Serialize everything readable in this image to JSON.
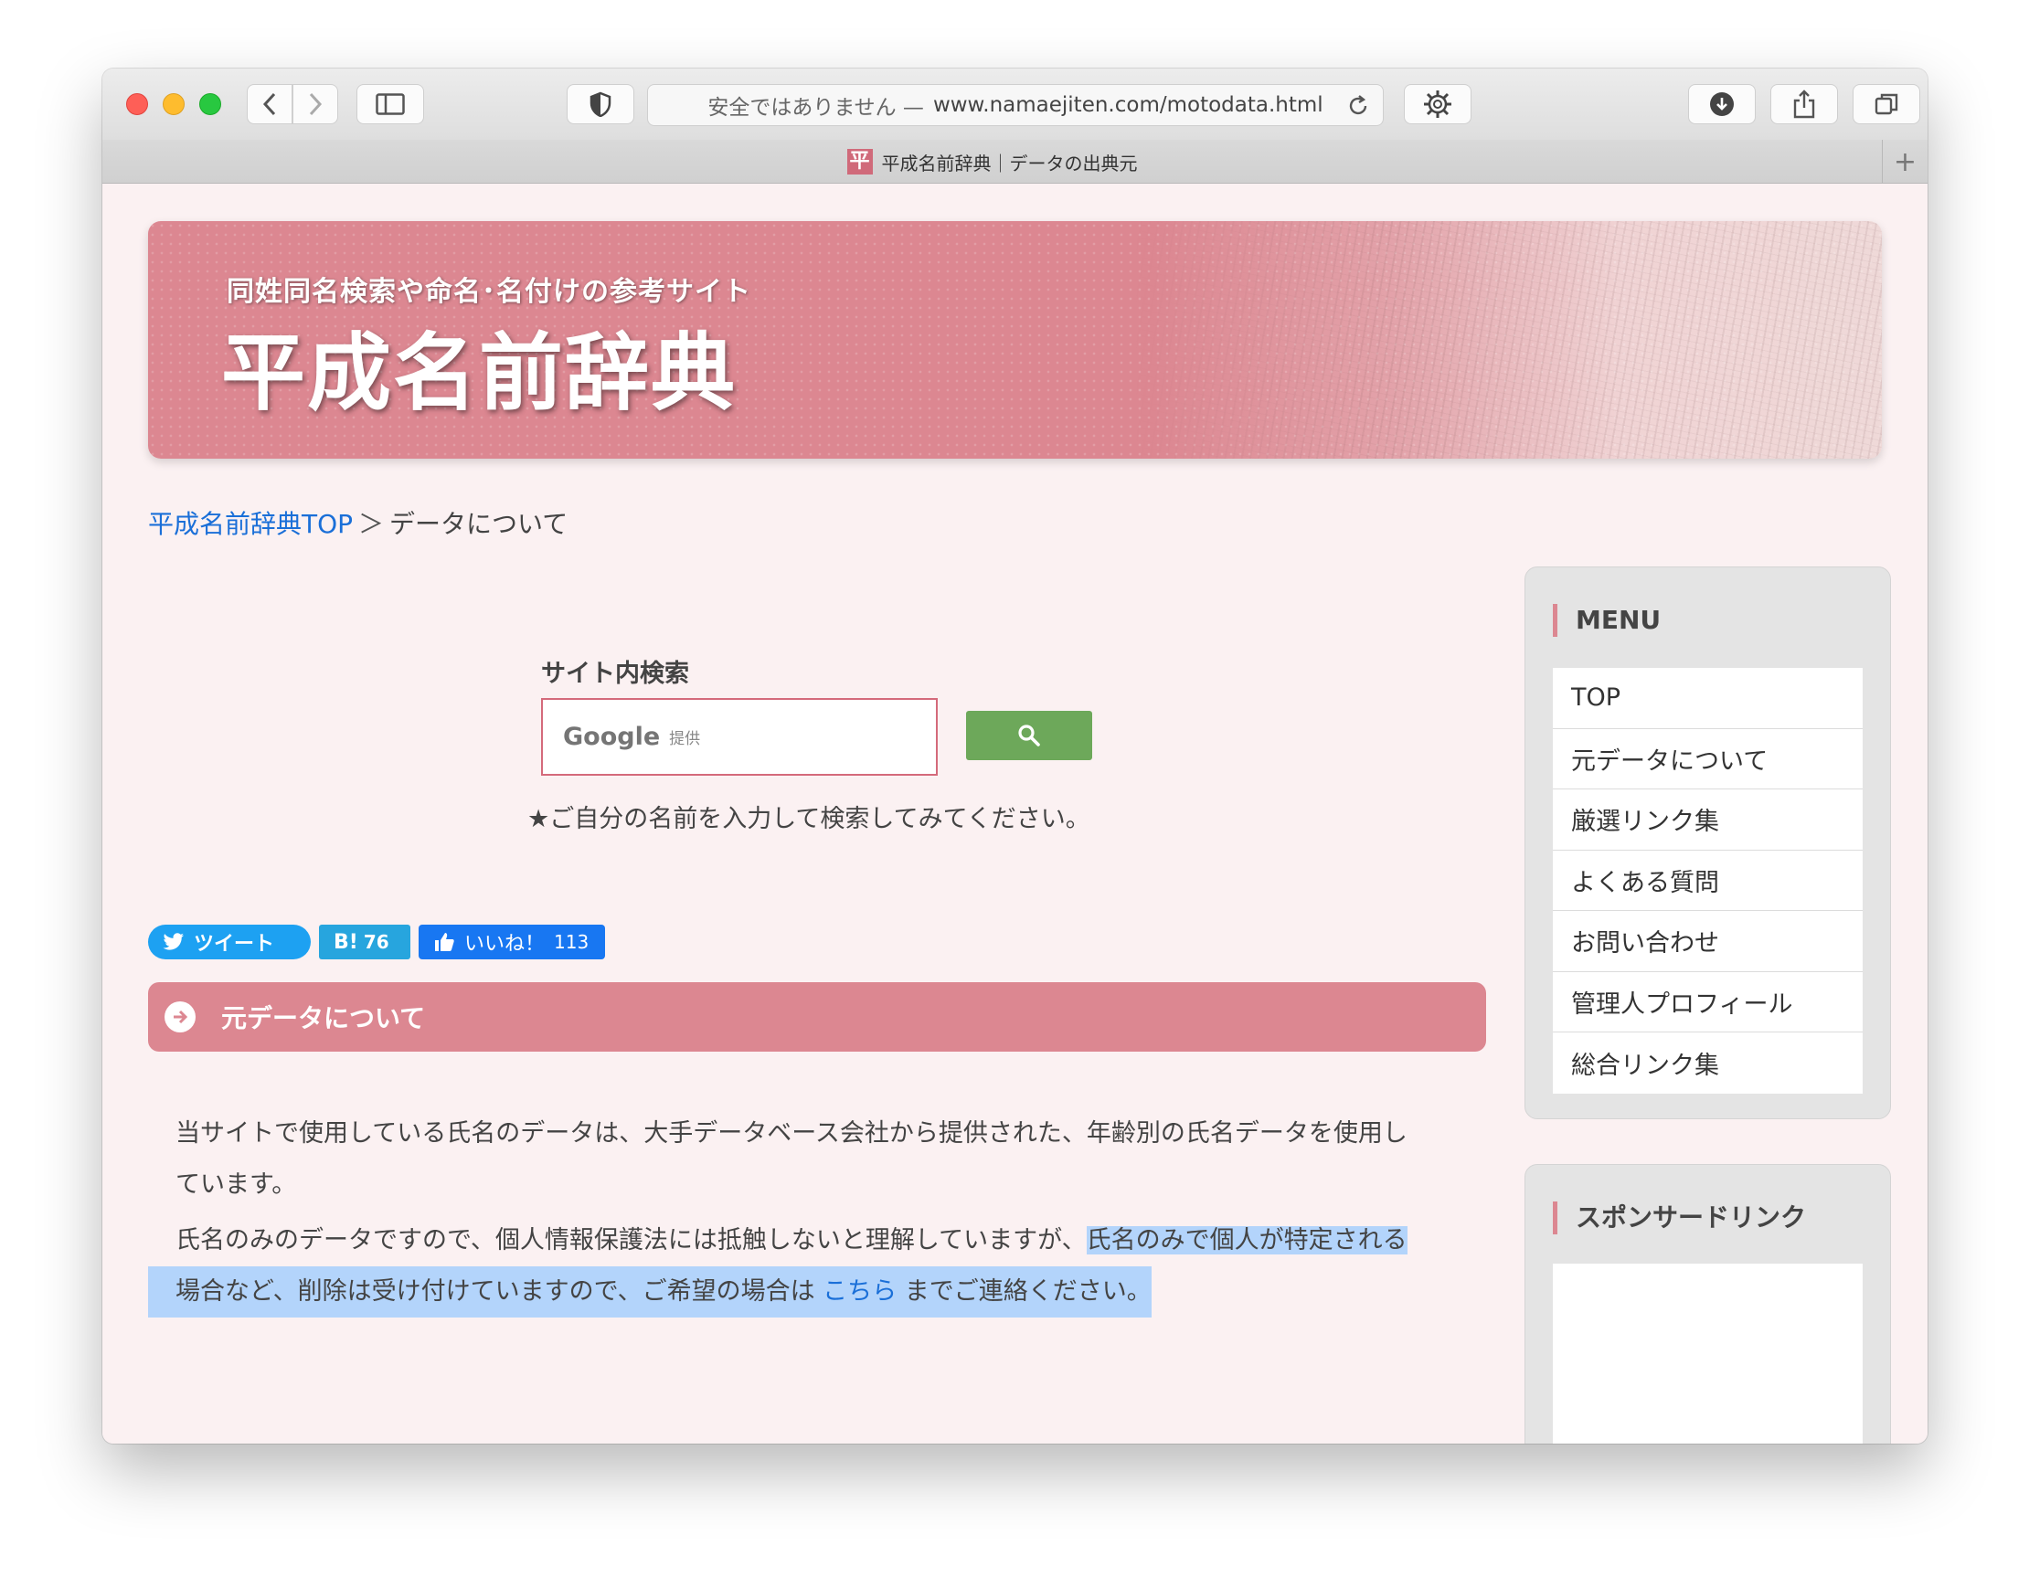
{
  "browser": {
    "address_insecure": "安全ではありません —",
    "address_url": "www.namaejiten.com/motodata.html",
    "tab_title": "平成名前辞典｜データの出典元",
    "favicon_char": "平",
    "new_tab": "+"
  },
  "banner": {
    "subtitle": "同姓同名検索や命名･名付けの参考サイト",
    "title": "平成名前辞典"
  },
  "breadcrumb": {
    "home": "平成名前辞典TOP",
    "separator": "＞",
    "current": "データについて"
  },
  "search": {
    "label": "サイト内検索",
    "google_text": "Google",
    "google_sub": "提供",
    "hint": "★ご自分の名前を入力して検索してみてください。"
  },
  "share": {
    "tweet": "ツイート",
    "hatena": "B!",
    "hatena_count": "76",
    "like": "いいね！",
    "like_count": "113"
  },
  "content": {
    "heading": "元データについて",
    "p1_line1": "当サイトで使用している氏名のデータは、大手データベース会社から提供された、年齢別の氏名データを使用し",
    "p1_line2": "ています。",
    "p2_line1_a": "氏名のみのデータですので、個人情報保護法には抵触しないと理解していますが、",
    "p2_line1_b": "氏名のみで個人が特定される",
    "p2_line2_a": "場合など、削除は受け付けていますので、ご希望の場合は",
    "p2_link": "こちら",
    "p2_line2_b": "までご連絡ください。"
  },
  "sidebar": {
    "menu_title": "MENU",
    "menu_items": [
      "TOP",
      "元データについて",
      "厳選リンク集",
      "よくある質問",
      "お問い合わせ",
      "管理人プロフィール",
      "総合リンク集"
    ],
    "sponsor_title": "スポンサードリンク"
  },
  "colors": {
    "accent_pink": "#dc8791",
    "link_blue": "#1a6fd8",
    "search_green": "#6da85a",
    "selection": "#b3d4fb"
  }
}
